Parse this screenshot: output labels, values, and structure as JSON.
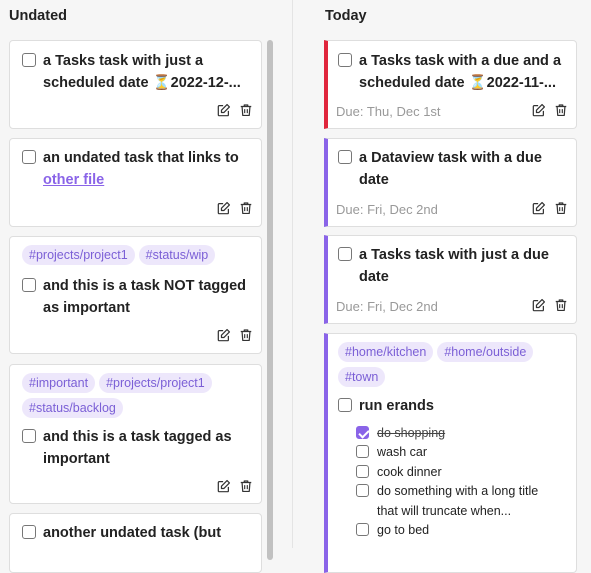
{
  "colors": {
    "accent_purple": "#8a64e8",
    "accent_red": "#e0263c",
    "tag_bg": "#ede7fb"
  },
  "columns": {
    "undated": {
      "title": "Undated",
      "cards": [
        {
          "text": "a Tasks task with just a scheduled date ⏳2022-12-..."
        },
        {
          "text_prefix": "an undated task that links to ",
          "link": "other file"
        },
        {
          "tags": [
            "#projects/project1",
            "#status/wip"
          ],
          "text": "and this is a task NOT tagged as important"
        },
        {
          "tags": [
            "#important",
            "#projects/project1",
            "#status/backlog"
          ],
          "text": "and this is a task tagged as important"
        },
        {
          "text": "another undated task (but"
        }
      ]
    },
    "today": {
      "title": "Today",
      "cards": [
        {
          "text": "a Tasks task with a due and a scheduled date ⏳2022-11-...",
          "due": "Due: Thu, Dec 1st"
        },
        {
          "text": "a Dataview task with a due date",
          "due": "Due: Fri, Dec 2nd"
        },
        {
          "text": "a Tasks task with just a due date",
          "due": "Due: Fri, Dec 2nd"
        },
        {
          "tags": [
            "#home/kitchen",
            "#home/outside",
            "#town"
          ],
          "text": "run erands",
          "subtasks": [
            {
              "text": "do shopping",
              "checked": true
            },
            {
              "text": "wash car",
              "checked": false
            },
            {
              "text": "cook dinner",
              "checked": false
            },
            {
              "text": "do something with a long title that will truncate when...",
              "checked": false
            },
            {
              "text": "go to bed",
              "checked": false
            }
          ]
        }
      ]
    }
  }
}
